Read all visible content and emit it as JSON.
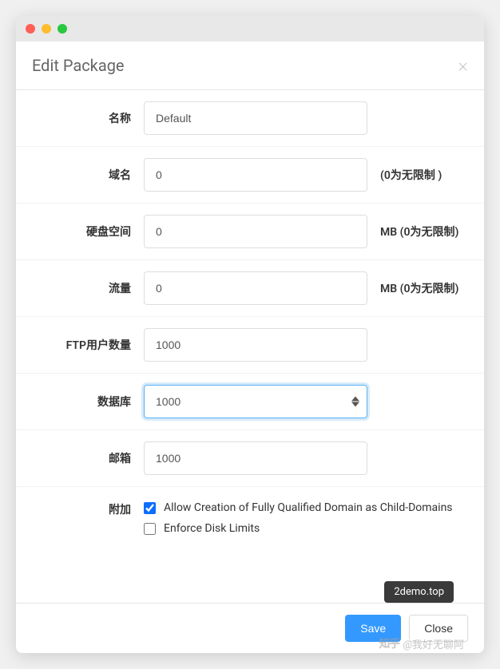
{
  "modal": {
    "title": "Edit Package",
    "close_symbol": "×"
  },
  "form": {
    "name": {
      "label": "名称",
      "value": "Default"
    },
    "domain": {
      "label": "域名",
      "value": "0",
      "suffix": "(0为无限制 )"
    },
    "disk": {
      "label": "硬盘空间",
      "value": "0",
      "suffix": "MB (0为无限制)"
    },
    "bandwidth": {
      "label": "流量",
      "value": "0",
      "suffix": "MB (0为无限制)"
    },
    "ftp": {
      "label": "FTP用户数量",
      "value": "1000"
    },
    "database": {
      "label": "数据库",
      "value": "1000"
    },
    "email": {
      "label": "邮箱",
      "value": "1000"
    },
    "addon": {
      "label": "附加",
      "option1": {
        "label": "Allow Creation of Fully Qualified Domain as Child-Domains",
        "checked": true
      },
      "option2": {
        "label": "Enforce Disk Limits",
        "checked": false
      }
    }
  },
  "footer": {
    "tooltip": "2demo.top",
    "save": "Save",
    "close": "Close"
  },
  "watermark": {
    "logo": "知乎",
    "text": "@我好无聊阿"
  }
}
